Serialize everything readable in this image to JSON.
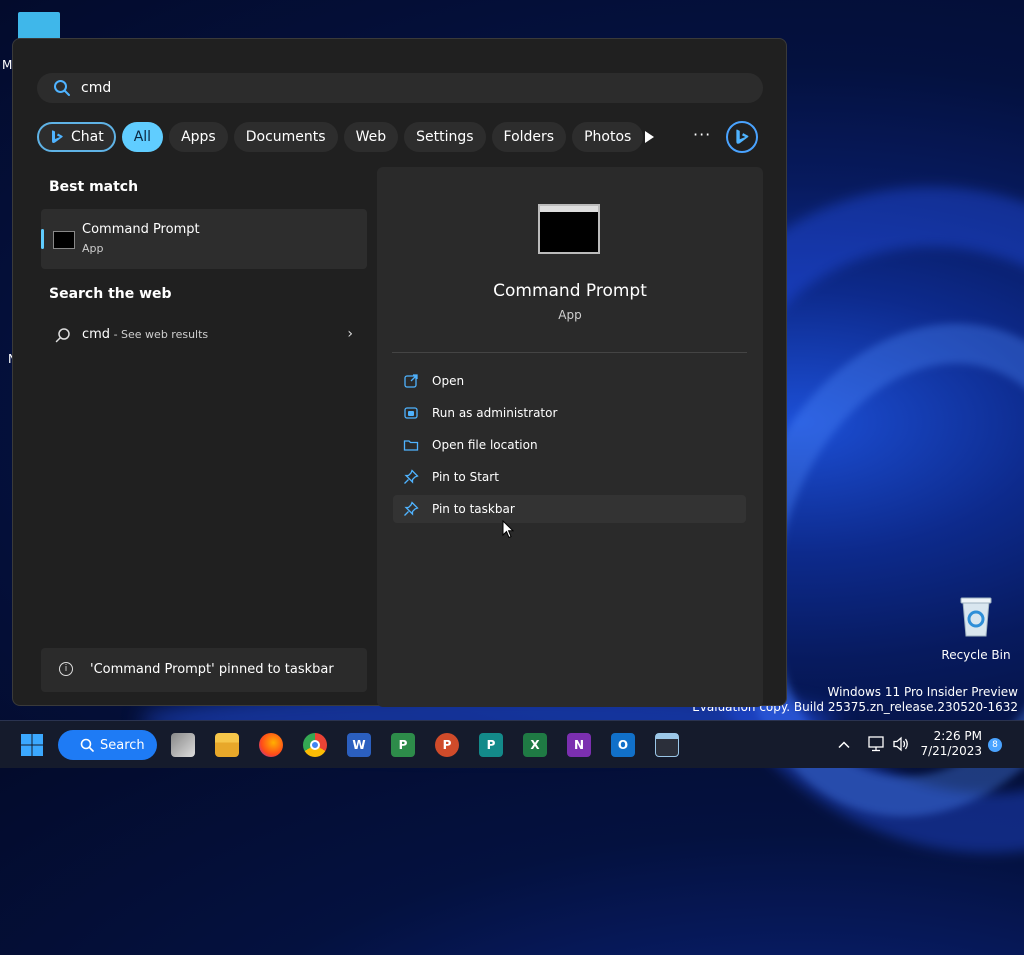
{
  "desktop": {
    "fragments": [
      "M",
      "N"
    ],
    "recycle_bin_label": "Recycle Bin",
    "watermark": {
      "line1": "Windows 11 Pro Insider Preview",
      "line2": "Evaluation copy. Build 25375.zn_release.230520-1632"
    }
  },
  "search": {
    "query": "cmd",
    "filters": {
      "chat": "Chat",
      "all": "All",
      "apps": "Apps",
      "documents": "Documents",
      "web": "Web",
      "settings": "Settings",
      "folders": "Folders",
      "photos": "Photos"
    },
    "more_label": "···"
  },
  "results": {
    "best_match_title": "Best match",
    "best_match": {
      "title": "Command Prompt",
      "subtitle": "App"
    },
    "search_web_title": "Search the web",
    "web_item": {
      "query": "cmd",
      "suffix": " - See web results",
      "chevron": "›"
    },
    "toast": {
      "info": "i",
      "text": "'Command Prompt' pinned to taskbar"
    }
  },
  "detail": {
    "name": "Command Prompt",
    "type": "App",
    "actions": {
      "open": "Open",
      "run_admin": "Run as administrator",
      "open_location": "Open file location",
      "pin_start": "Pin to Start",
      "pin_taskbar": "Pin to taskbar"
    }
  },
  "taskbar": {
    "search_label": "Search",
    "apps": {
      "word": "W",
      "project": "P",
      "powerpoint": "P",
      "publisher": "P",
      "excel": "X",
      "onenote": "N",
      "outlook": "O"
    },
    "time": "2:26 PM",
    "date": "7/21/2023",
    "notification_count": "8"
  },
  "colors": {
    "accent": "#60cdff",
    "taskbar_search": "#1e7bf5"
  }
}
